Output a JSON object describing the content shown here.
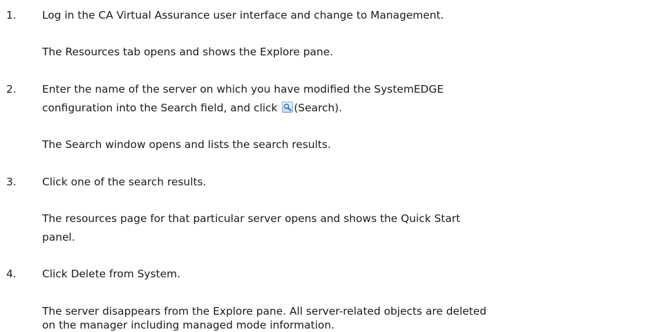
{
  "steps": [
    {
      "number": "1.",
      "instruction": "Log in the CA Virtual Assurance user interface and change to Management.",
      "result": "The Resources tab opens and shows the Explore pane."
    },
    {
      "number": "2.",
      "instruction_line1": "Enter the name of the server on which you have modified the SystemEDGE",
      "instruction_line2_before": "configuration into the Search field, and click",
      "instruction_line2_after": "(Search).",
      "icon": "search-icon",
      "result": "The Search window opens and lists the search results."
    },
    {
      "number": "3.",
      "instruction": "Click one of the search results.",
      "result_line1": "The resources page for that particular server opens and shows the Quick Start",
      "result_line2": "panel."
    },
    {
      "number": "4.",
      "instruction": "Click Delete from System.",
      "result_line1": "The server disappears from the Explore pane. All server-related objects are deleted",
      "result_line2": "on the manager including managed mode information."
    }
  ]
}
